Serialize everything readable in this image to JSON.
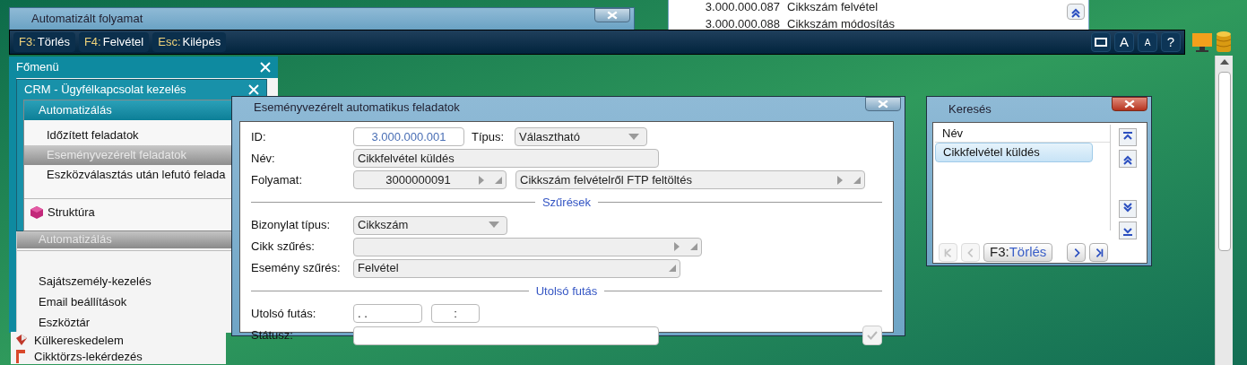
{
  "background_list": {
    "rows": [
      {
        "id": "3.000.000.087",
        "name": "Cikkszám felvétel"
      },
      {
        "id": "3.000.000.088",
        "name": "Cikkszám módosítás"
      }
    ]
  },
  "process_window": {
    "title": "Automatizált folyamat"
  },
  "toolbar": {
    "shortcuts": [
      {
        "key": "F3:",
        "label": "Törlés"
      },
      {
        "key": "F4:",
        "label": "Felvétel"
      },
      {
        "key": "Esc:",
        "label": "Kilépés"
      }
    ],
    "buttons": [
      {
        "kind": "window"
      },
      {
        "kind": "font-large",
        "label": "A"
      },
      {
        "kind": "font-small",
        "label": "A"
      },
      {
        "kind": "help",
        "label": "?"
      }
    ]
  },
  "main_menu": {
    "title": "Főmenü",
    "crm": {
      "title": "CRM - Ügyfélkapcsolat kezelés",
      "group": "Automatizálás",
      "items": [
        {
          "label": "Időzített feladatok",
          "selected": false
        },
        {
          "label": "Eseményvezérelt feladatok",
          "selected": true
        },
        {
          "label": "Eszközválasztás után lefutó felada",
          "selected": false
        }
      ],
      "structure": "Struktúra"
    },
    "items": [
      {
        "kind": "group",
        "label": "Automatizálás"
      },
      {
        "kind": "spacer"
      },
      {
        "kind": "item",
        "label": "Sajátszemély-kezelés"
      },
      {
        "kind": "item",
        "label": "Email beállítások"
      },
      {
        "kind": "item",
        "label": "Eszköztár"
      }
    ],
    "below": [
      {
        "kind": "trade",
        "label": "Külkereskedelem"
      },
      {
        "kind": "query",
        "label": "Cikktörzs-lekérdezés"
      }
    ]
  },
  "dialog": {
    "title": "Eseményvezérelt automatikus feladatok",
    "id_label": "ID:",
    "id_value": "3.000.000.001",
    "type_label": "Típus:",
    "type_value": "Választható",
    "name_label": "Név:",
    "name_value": "Cikkfelvétel küldés",
    "process_label": "Folyamat:",
    "process_code": "3000000091",
    "process_name": "Cikkszám felvételről FTP feltöltés",
    "filters_heading": "Szűrések",
    "doc_type_label": "Bizonylat típus:",
    "doc_type_value": "Cikkszám",
    "item_filter_label": "Cikk szűrés:",
    "event_filter_label": "Esemény szűrés:",
    "event_filter_value": "Felvétel",
    "last_run_heading": "Utolsó futás",
    "last_run_label": "Utolsó futás:",
    "last_run_date": ". .",
    "last_run_time": ":",
    "status_label": "Státusz:"
  },
  "search": {
    "title": "Keresés",
    "header": "Név",
    "rows": [
      {
        "label": "Cikkfelvétel küldés",
        "selected": true
      }
    ],
    "nav_buttons": [
      {
        "kind": "first",
        "disabled": true
      },
      {
        "kind": "prev",
        "disabled": true
      },
      {
        "kind": "next",
        "disabled": false
      },
      {
        "kind": "last",
        "disabled": false
      }
    ],
    "clear_key": "F3:",
    "clear_label": "Törlés"
  }
}
